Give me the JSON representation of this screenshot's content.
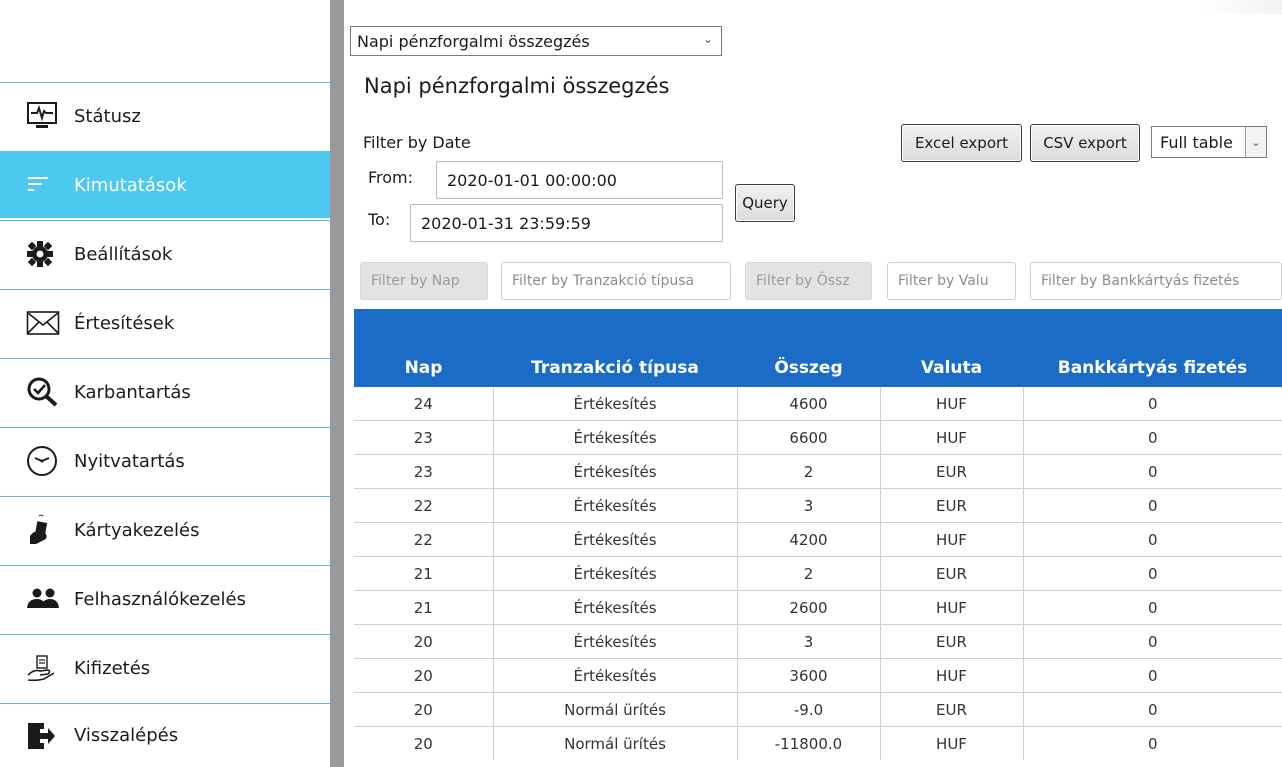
{
  "sidebar": {
    "items": [
      {
        "label": "Státusz",
        "icon": "monitor-icon",
        "active": false
      },
      {
        "label": "Kimutatások",
        "icon": "report-lines-icon",
        "active": true
      },
      {
        "label": "Beállítások",
        "icon": "gear-icon",
        "active": false
      },
      {
        "label": "Értesítések",
        "icon": "envelope-icon",
        "active": false
      },
      {
        "label": "Karbantartás",
        "icon": "magnifier-check-icon",
        "active": false
      },
      {
        "label": "Nyitvatartás",
        "icon": "clock-icon",
        "active": false
      },
      {
        "label": "Kártyakezelés",
        "icon": "hand-card-icon",
        "active": false
      },
      {
        "label": "Felhasználókezelés",
        "icon": "users-icon",
        "active": false
      },
      {
        "label": "Kifizetés",
        "icon": "hand-cash-icon",
        "active": false
      },
      {
        "label": "Visszalépés",
        "icon": "exit-door-icon",
        "active": false
      }
    ],
    "colors": {
      "active_bg": "#4dc8ee",
      "divider": "#5fb3e8"
    }
  },
  "report_select": {
    "value": "Napi pénzforgalmi összegzés"
  },
  "page_title": "Napi pénzforgalmi összegzés",
  "date_filter": {
    "label": "Filter by Date",
    "from_label": "From:",
    "from_value": "2020-01-01 00:00:00",
    "to_label": "To:",
    "to_value": "2020-01-31 23:59:59",
    "query_label": "Query"
  },
  "toolbar": {
    "excel_label": "Excel export",
    "csv_label": "CSV export",
    "view_select_value": "Full table"
  },
  "column_filters": [
    "Filter by Nap",
    "Filter by Tranzakció típusa",
    "Filter by Össz",
    "Filter by Valu",
    "Filter by Bankkártyás fizetés"
  ],
  "table": {
    "header_color": "#1b6cc7",
    "columns": [
      "Nap",
      "Tranzakció típusa",
      "Összeg",
      "Valuta",
      "Bankkártyás fizetés"
    ],
    "rows": [
      [
        "24",
        "Értékesítés",
        "4600",
        "HUF",
        "0"
      ],
      [
        "23",
        "Értékesítés",
        "6600",
        "HUF",
        "0"
      ],
      [
        "23",
        "Értékesítés",
        "2",
        "EUR",
        "0"
      ],
      [
        "22",
        "Értékesítés",
        "3",
        "EUR",
        "0"
      ],
      [
        "22",
        "Értékesítés",
        "4200",
        "HUF",
        "0"
      ],
      [
        "21",
        "Értékesítés",
        "2",
        "EUR",
        "0"
      ],
      [
        "21",
        "Értékesítés",
        "2600",
        "HUF",
        "0"
      ],
      [
        "20",
        "Értékesítés",
        "3",
        "EUR",
        "0"
      ],
      [
        "20",
        "Értékesítés",
        "3600",
        "HUF",
        "0"
      ],
      [
        "20",
        "Normál ürítés",
        "-9.0",
        "EUR",
        "0"
      ],
      [
        "20",
        "Normál ürítés",
        "-11800.0",
        "HUF",
        "0"
      ]
    ]
  }
}
